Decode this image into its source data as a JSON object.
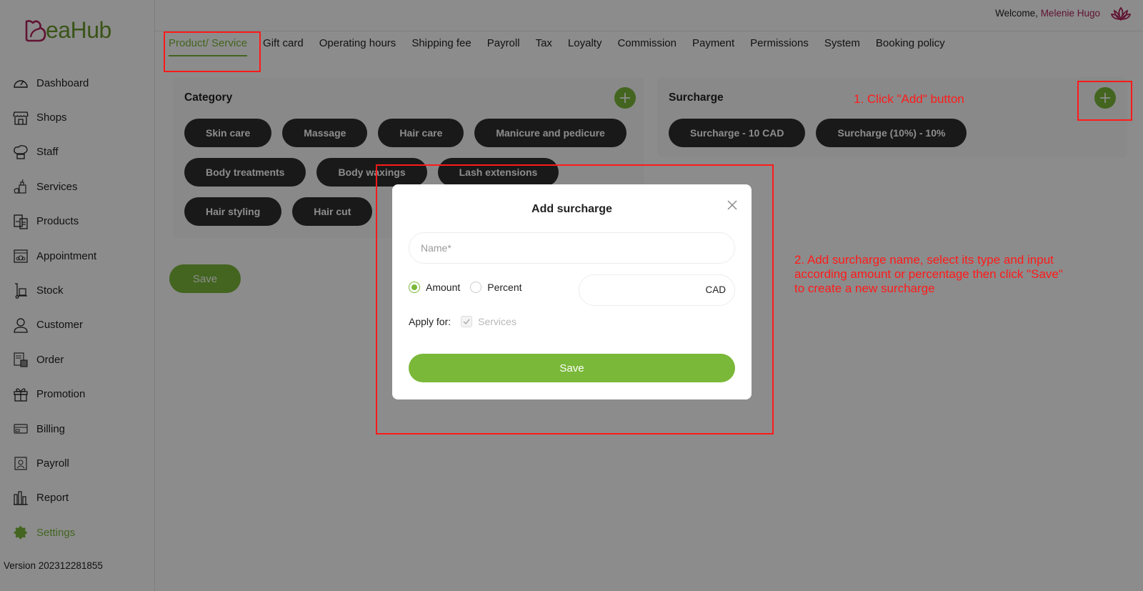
{
  "brand": {
    "name": "eaHub",
    "logo_letter_icon": "heart-b-icon",
    "accent": "#7ab839",
    "brand_pink": "#b0245a"
  },
  "header": {
    "welcome_prefix": "Welcome, ",
    "user_name": "Melenie Hugo",
    "user_icon": "lotus-icon"
  },
  "sidebar": {
    "items": [
      {
        "label": "Dashboard",
        "icon": "dashboard-icon",
        "active": false
      },
      {
        "label": "Shops",
        "icon": "shop-icon",
        "active": false
      },
      {
        "label": "Staff",
        "icon": "chef-hat-icon",
        "active": false
      },
      {
        "label": "Services",
        "icon": "services-icon",
        "active": false
      },
      {
        "label": "Products",
        "icon": "products-icon",
        "active": false
      },
      {
        "label": "Appointment",
        "icon": "calendar-icon",
        "active": false
      },
      {
        "label": "Stock",
        "icon": "hand-truck-icon",
        "active": false
      },
      {
        "label": "Customer",
        "icon": "user-icon",
        "active": false
      },
      {
        "label": "Order",
        "icon": "order-icon",
        "active": false
      },
      {
        "label": "Promotion",
        "icon": "gift-icon",
        "active": false
      },
      {
        "label": "Billing",
        "icon": "billing-icon",
        "active": false
      },
      {
        "label": "Payroll",
        "icon": "payroll-icon",
        "active": false
      },
      {
        "label": "Report",
        "icon": "bar-chart-icon",
        "active": false
      },
      {
        "label": "Settings",
        "icon": "gear-icon",
        "active": true
      }
    ],
    "version": "Version 202312281855"
  },
  "tabs": [
    {
      "label": "Product/ Service",
      "active": true
    },
    {
      "label": "Gift card"
    },
    {
      "label": "Operating hours"
    },
    {
      "label": "Shipping fee"
    },
    {
      "label": "Payroll"
    },
    {
      "label": "Tax"
    },
    {
      "label": "Loyalty"
    },
    {
      "label": "Commission"
    },
    {
      "label": "Payment"
    },
    {
      "label": "Permissions"
    },
    {
      "label": "System"
    },
    {
      "label": "Booking policy"
    }
  ],
  "category": {
    "title": "Category",
    "items": [
      "Skin care",
      "Massage",
      "Hair care",
      "Manicure and pedicure",
      "Body treatments",
      "Body waxings",
      "Lash extensions",
      "Hair styling",
      "Hair cut"
    ]
  },
  "surcharge": {
    "title": "Surcharge",
    "items": [
      "Surcharge - 10 CAD",
      "Surcharge (10%) - 10%"
    ]
  },
  "main_save_label": "Save",
  "modal": {
    "title": "Add surcharge",
    "name_placeholder": "Name*",
    "name_value": "",
    "type_options": [
      {
        "label": "Amount",
        "checked": true
      },
      {
        "label": "Percent",
        "checked": false
      }
    ],
    "amount_value": "",
    "amount_unit": "CAD",
    "apply_for_label": "Apply for:",
    "apply_options": [
      {
        "label": "Services",
        "checked": true,
        "disabled": true
      }
    ],
    "save_label": "Save"
  },
  "annotations": {
    "step1": "1. Click \"Add\" button",
    "step2_lines": [
      "2. Add surcharge name, select its type and input",
      "according amount or percentage then click \"Save\"",
      "to create a new surcharge"
    ]
  }
}
